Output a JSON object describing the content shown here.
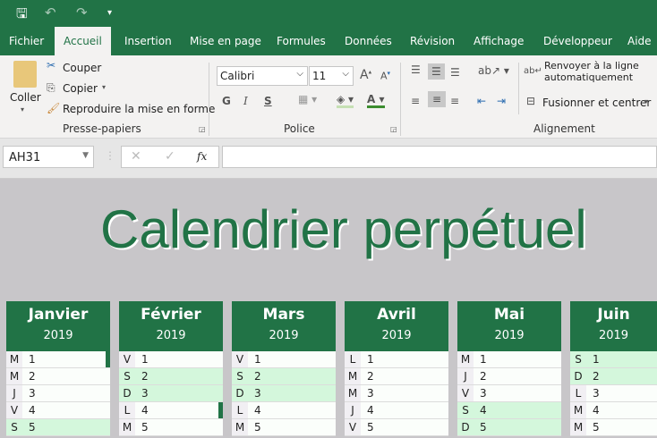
{
  "qat": {
    "save_icon": "save-icon",
    "undo_icon": "undo-icon",
    "redo_icon": "redo-icon",
    "customize_icon": "chevron-down-icon"
  },
  "tabs": [
    {
      "label": "Fichier"
    },
    {
      "label": "Accueil",
      "active": true
    },
    {
      "label": "Insertion"
    },
    {
      "label": "Mise en page"
    },
    {
      "label": "Formules"
    },
    {
      "label": "Données"
    },
    {
      "label": "Révision"
    },
    {
      "label": "Affichage"
    },
    {
      "label": "Développeur"
    },
    {
      "label": "Aide"
    }
  ],
  "ribbon": {
    "clipboard": {
      "paste": "Coller",
      "cut": "Couper",
      "copy": "Copier",
      "format_painter": "Reproduire la mise en forme",
      "group": "Presse-papiers"
    },
    "font": {
      "name": "Calibri",
      "size": "11",
      "bold": "G",
      "italic": "I",
      "underline": "S",
      "group": "Police"
    },
    "alignment": {
      "wrap": "Renvoyer à la ligne automatiquement",
      "merge": "Fusionner et centrer",
      "group": "Alignement"
    }
  },
  "formula_bar": {
    "name_box": "AH31",
    "fx": "fx",
    "value": ""
  },
  "sheet": {
    "title": "Calendrier perpétuel",
    "months": [
      {
        "name": "Janvier",
        "year": "2019",
        "days": [
          {
            "dw": "M",
            "d": "1",
            "we": false,
            "marker": true
          },
          {
            "dw": "M",
            "d": "2",
            "we": false
          },
          {
            "dw": "J",
            "d": "3",
            "we": false
          },
          {
            "dw": "V",
            "d": "4",
            "we": false
          },
          {
            "dw": "S",
            "d": "5",
            "we": true
          }
        ]
      },
      {
        "name": "Février",
        "year": "2019",
        "days": [
          {
            "dw": "V",
            "d": "1",
            "we": false
          },
          {
            "dw": "S",
            "d": "2",
            "we": true
          },
          {
            "dw": "D",
            "d": "3",
            "we": true
          },
          {
            "dw": "L",
            "d": "4",
            "we": false,
            "marker": true
          },
          {
            "dw": "M",
            "d": "5",
            "we": false
          }
        ]
      },
      {
        "name": "Mars",
        "year": "2019",
        "days": [
          {
            "dw": "V",
            "d": "1",
            "we": false
          },
          {
            "dw": "S",
            "d": "2",
            "we": true
          },
          {
            "dw": "D",
            "d": "3",
            "we": true
          },
          {
            "dw": "L",
            "d": "4",
            "we": false
          },
          {
            "dw": "M",
            "d": "5",
            "we": false
          }
        ]
      },
      {
        "name": "Avril",
        "year": "2019",
        "days": [
          {
            "dw": "L",
            "d": "1",
            "we": false
          },
          {
            "dw": "M",
            "d": "2",
            "we": false
          },
          {
            "dw": "M",
            "d": "3",
            "we": false
          },
          {
            "dw": "J",
            "d": "4",
            "we": false
          },
          {
            "dw": "V",
            "d": "5",
            "we": false
          }
        ]
      },
      {
        "name": "Mai",
        "year": "2019",
        "days": [
          {
            "dw": "M",
            "d": "1",
            "we": false
          },
          {
            "dw": "J",
            "d": "2",
            "we": false
          },
          {
            "dw": "V",
            "d": "3",
            "we": false
          },
          {
            "dw": "S",
            "d": "4",
            "we": true
          },
          {
            "dw": "D",
            "d": "5",
            "we": true
          }
        ]
      },
      {
        "name": "Juin",
        "year": "2019",
        "days": [
          {
            "dw": "S",
            "d": "1",
            "we": true
          },
          {
            "dw": "D",
            "d": "2",
            "we": true
          },
          {
            "dw": "L",
            "d": "3",
            "we": false
          },
          {
            "dw": "M",
            "d": "4",
            "we": false
          },
          {
            "dw": "M",
            "d": "5",
            "we": false
          }
        ]
      }
    ]
  }
}
